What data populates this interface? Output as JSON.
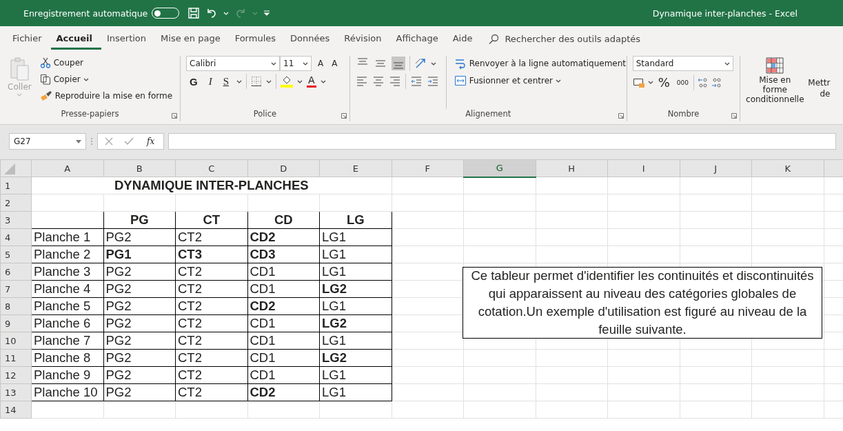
{
  "title_bar": {
    "autosave_label": "Enregistrement automatique",
    "autosave_on": false,
    "title": "Dynamique inter-planches  -  Excel",
    "quick_access": [
      {
        "kind": "save",
        "disabled": false
      },
      {
        "kind": "undo",
        "disabled": false
      },
      {
        "kind": "redo",
        "disabled": true
      },
      {
        "kind": "customize",
        "disabled": false
      }
    ]
  },
  "menu_tabs": [
    {
      "label": "Fichier",
      "selected": false
    },
    {
      "label": "Accueil",
      "selected": true
    },
    {
      "label": "Insertion",
      "selected": false
    },
    {
      "label": "Mise en page",
      "selected": false
    },
    {
      "label": "Formules",
      "selected": false
    },
    {
      "label": "Données",
      "selected": false
    },
    {
      "label": "Révision",
      "selected": false
    },
    {
      "label": "Affichage",
      "selected": false
    },
    {
      "label": "Aide",
      "selected": false
    }
  ],
  "search": {
    "placeholder": "Rechercher des outils adaptés"
  },
  "ribbon": {
    "clipboard": {
      "label": "Presse-papiers",
      "paste": {
        "label": "Coller",
        "disabled": true
      },
      "cut": "Couper",
      "copy": "Copier",
      "format_painter": "Reproduire la mise en forme"
    },
    "font": {
      "label": "Police",
      "font_name": "Calibri",
      "font_size": "11",
      "grow": "A",
      "shrink": "A",
      "bold": "G",
      "italic": "I",
      "underline": "S",
      "font_color": "A"
    },
    "alignment": {
      "label": "Alignement",
      "vertical": [
        {
          "kind": "top",
          "selected": false
        },
        {
          "kind": "middle",
          "selected": false
        },
        {
          "kind": "bottom",
          "selected": true
        }
      ],
      "wrap": "Renvoyer à la ligne automatiquement",
      "merge": "Fusionner et centrer"
    },
    "number": {
      "label": "Nombre",
      "format": "Standard",
      "percent": "%",
      "thousands": "000"
    },
    "styles": {
      "conditional": "Mise en forme conditionnelle",
      "next_cut": [
        "Mettr",
        "de"
      ]
    }
  },
  "formula_bar": {
    "name_box": "G27",
    "function_label": "fx"
  },
  "columns": [
    {
      "label": "A",
      "selected": false
    },
    {
      "label": "B",
      "selected": false
    },
    {
      "label": "C",
      "selected": false
    },
    {
      "label": "D",
      "selected": false
    },
    {
      "label": "E",
      "selected": false
    },
    {
      "label": "F",
      "selected": false
    },
    {
      "label": "G",
      "selected": true
    },
    {
      "label": "H",
      "selected": false
    },
    {
      "label": "I",
      "selected": false
    },
    {
      "label": "J",
      "selected": false
    },
    {
      "label": "K",
      "selected": false
    }
  ],
  "rows": [
    {
      "number": "1",
      "title": "DYNAMIQUE INTER-PLANCHES"
    },
    {
      "number": "2"
    },
    {
      "number": "3",
      "headers": [
        {
          "text": "PG",
          "bold": true
        },
        {
          "text": "CT",
          "bold": true
        },
        {
          "text": "CD",
          "bold": true
        },
        {
          "text": "LG",
          "bold": true
        }
      ]
    },
    {
      "number": "4",
      "cells": [
        {
          "text": "Planche 1",
          "bold": false
        },
        {
          "text": "PG2",
          "bold": false
        },
        {
          "text": "CT2",
          "bold": false
        },
        {
          "text": "CD2",
          "bold": true
        },
        {
          "text": "LG1",
          "bold": false
        }
      ]
    },
    {
      "number": "5",
      "cells": [
        {
          "text": "Planche 2",
          "bold": false
        },
        {
          "text": "PG1",
          "bold": true
        },
        {
          "text": "CT3",
          "bold": true
        },
        {
          "text": "CD3",
          "bold": true
        },
        {
          "text": "LG1",
          "bold": false
        }
      ]
    },
    {
      "number": "6",
      "cells": [
        {
          "text": "Planche 3",
          "bold": false
        },
        {
          "text": "PG2",
          "bold": false
        },
        {
          "text": "CT2",
          "bold": false
        },
        {
          "text": "CD1",
          "bold": false
        },
        {
          "text": "LG1",
          "bold": false
        }
      ]
    },
    {
      "number": "7",
      "cells": [
        {
          "text": "Planche 4",
          "bold": false
        },
        {
          "text": "PG2",
          "bold": false
        },
        {
          "text": "CT2",
          "bold": false
        },
        {
          "text": "CD1",
          "bold": false
        },
        {
          "text": "LG2",
          "bold": true
        }
      ]
    },
    {
      "number": "8",
      "cells": [
        {
          "text": "Planche 5",
          "bold": false
        },
        {
          "text": "PG2",
          "bold": false
        },
        {
          "text": "CT2",
          "bold": false
        },
        {
          "text": "CD2",
          "bold": true
        },
        {
          "text": "LG1",
          "bold": false
        }
      ]
    },
    {
      "number": "9",
      "cells": [
        {
          "text": "Planche 6",
          "bold": false
        },
        {
          "text": "PG2",
          "bold": false
        },
        {
          "text": "CT2",
          "bold": false
        },
        {
          "text": "CD1",
          "bold": false
        },
        {
          "text": "LG2",
          "bold": true
        }
      ]
    },
    {
      "number": "10",
      "cells": [
        {
          "text": "Planche 7",
          "bold": false
        },
        {
          "text": "PG2",
          "bold": false
        },
        {
          "text": "CT2",
          "bold": false
        },
        {
          "text": "CD1",
          "bold": false
        },
        {
          "text": "LG1",
          "bold": false
        }
      ]
    },
    {
      "number": "11",
      "cells": [
        {
          "text": "Planche 8",
          "bold": false
        },
        {
          "text": "PG2",
          "bold": false
        },
        {
          "text": "CT2",
          "bold": false
        },
        {
          "text": "CD1",
          "bold": false
        },
        {
          "text": "LG2",
          "bold": true
        }
      ]
    },
    {
      "number": "12",
      "cells": [
        {
          "text": "Planche 9",
          "bold": false
        },
        {
          "text": "PG2",
          "bold": false
        },
        {
          "text": "CT2",
          "bold": false
        },
        {
          "text": "CD1",
          "bold": false
        },
        {
          "text": "LG1",
          "bold": false
        }
      ]
    },
    {
      "number": "13",
      "cells": [
        {
          "text": "Planche 10",
          "bold": false
        },
        {
          "text": "PG2",
          "bold": false
        },
        {
          "text": "CT2",
          "bold": false
        },
        {
          "text": "CD2",
          "bold": true
        },
        {
          "text": "LG1",
          "bold": false
        }
      ]
    },
    {
      "number": "14"
    }
  ],
  "text_box": {
    "text": "Ce tableur permet d'identifier les continuités et discontinuités qui apparaissent au niveau des catégories globales de cotation.Un exemple d'utilisation est figuré au niveau de la feuille suivante."
  }
}
